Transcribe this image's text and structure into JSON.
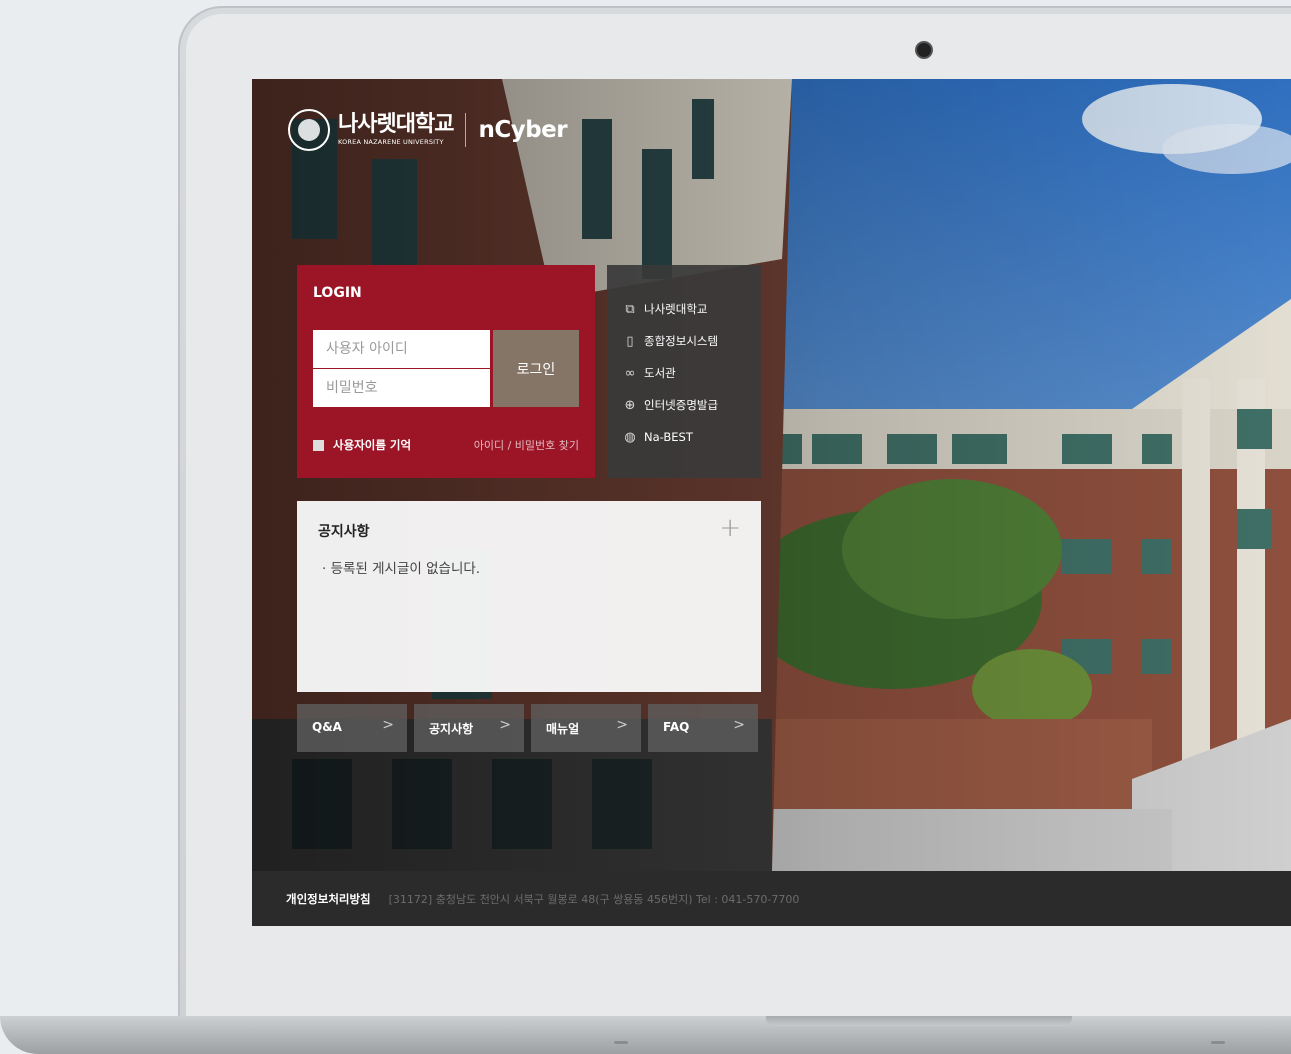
{
  "brand": {
    "university_kr": "나사렛대학교",
    "university_en": "KOREA NAZARENE UNIVERSITY",
    "site": "nCyber"
  },
  "login": {
    "title": "LOGIN",
    "id_placeholder": "사용자 아이디",
    "pw_placeholder": "비밀번호",
    "submit": "로그인",
    "remember_label": "사용자이름 기억",
    "find_link": "아이디 / 비밀번호 찾기"
  },
  "shortcuts": [
    {
      "icon": "layers-icon",
      "glyph": "⧉",
      "label": "나사렛대학교"
    },
    {
      "icon": "book-icon",
      "glyph": "▯",
      "label": "종합정보시스템"
    },
    {
      "icon": "link-icon",
      "glyph": "∞",
      "label": "도서관"
    },
    {
      "icon": "crosshair-icon",
      "glyph": "⊕",
      "label": "인터넷증명발급"
    },
    {
      "icon": "globe-icon",
      "glyph": "◍",
      "label": "Na-BEST"
    }
  ],
  "notice": {
    "title": "공지사항",
    "more": "+",
    "empty": "· 등록된 게시글이 없습니다."
  },
  "tiles": [
    {
      "label": "Q&A",
      "arrow": ">"
    },
    {
      "label": "공지사항",
      "arrow": ">"
    },
    {
      "label": "매뉴얼",
      "arrow": ">"
    },
    {
      "label": "FAQ",
      "arrow": ">"
    }
  ],
  "footer": {
    "privacy": "개인정보처리방침",
    "address": "[31172] 충청남도 천안시 서북구 월봉로 48(구 쌍용동 456번지)   Tel : 041-570-7700"
  },
  "colors": {
    "login_bg": "#9b1527",
    "login_btn": "#857566",
    "shortcut_bg": "#3a3a3a",
    "footer_bg": "#2b2b2b"
  }
}
